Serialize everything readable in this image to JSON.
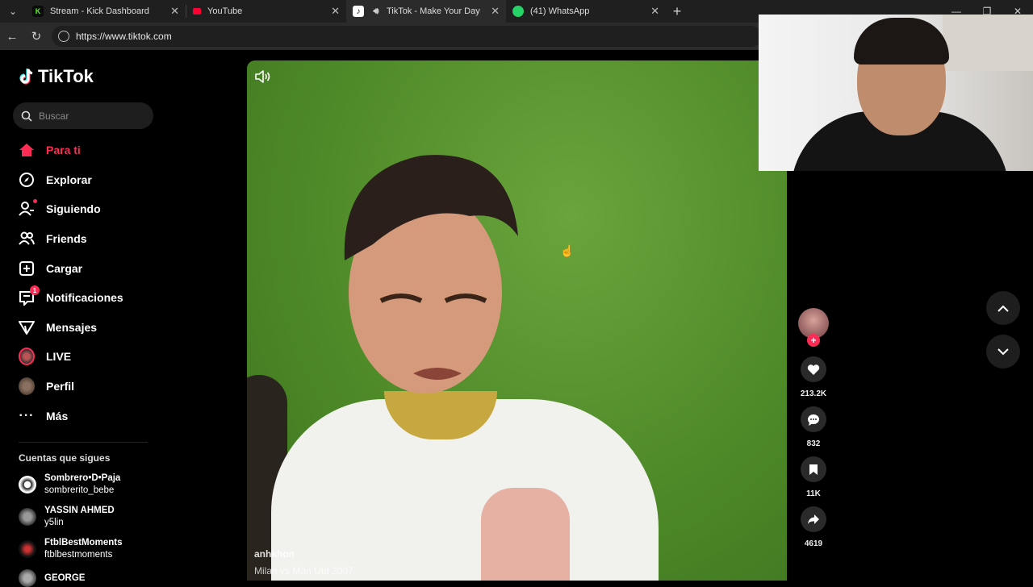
{
  "browser": {
    "tabs": [
      {
        "title": "Stream - Kick Dashboard",
        "favicon": "K",
        "favicon_color": "#53fc18",
        "active": false
      },
      {
        "title": "YouTube",
        "favicon": "",
        "favicon_color": "#ff0033",
        "active": false
      },
      {
        "title": "TikTok - Make Your Day",
        "favicon": "tiktok-icon",
        "favicon_color": "#000000",
        "active": true
      },
      {
        "title": "(41) WhatsApp",
        "favicon": "whatsapp-icon",
        "favicon_color": "#25d366",
        "active": false
      }
    ],
    "url": "https://www.tiktok.com"
  },
  "tiktok": {
    "logo_text": "TikTok",
    "search_placeholder": "Buscar",
    "nav": [
      {
        "label": "Para ti",
        "icon": "home-icon",
        "active": true
      },
      {
        "label": "Explorar",
        "icon": "compass-icon"
      },
      {
        "label": "Siguiendo",
        "icon": "following-icon"
      },
      {
        "label": "Friends",
        "icon": "friends-icon"
      },
      {
        "label": "Cargar",
        "icon": "upload-icon"
      },
      {
        "label": "Notificaciones",
        "icon": "inbox-icon",
        "badge": "1"
      },
      {
        "label": "Mensajes",
        "icon": "send-icon"
      },
      {
        "label": "LIVE",
        "icon": "live-icon"
      },
      {
        "label": "Perfil",
        "icon": "profile-icon"
      },
      {
        "label": "Más",
        "icon": "more-icon"
      }
    ],
    "following_title": "Cuentas que sigues",
    "following": [
      {
        "name": "Sombrero•D•Paja",
        "handle": "sombrerito_bebe"
      },
      {
        "name": "YASSIN AHMED",
        "handle": "y5lin"
      },
      {
        "name": "FtblBestMoments",
        "handle": "ftblbestmoments"
      },
      {
        "name": "GEORGE",
        "handle": ""
      }
    ],
    "video": {
      "author": "anhkhon",
      "description": "Milan vs Man Utd 2007"
    },
    "actions": {
      "likes": "213.2K",
      "comments": "832",
      "saves": "11K",
      "shares": "4619"
    },
    "colors": {
      "accent": "#fe2c55"
    }
  }
}
